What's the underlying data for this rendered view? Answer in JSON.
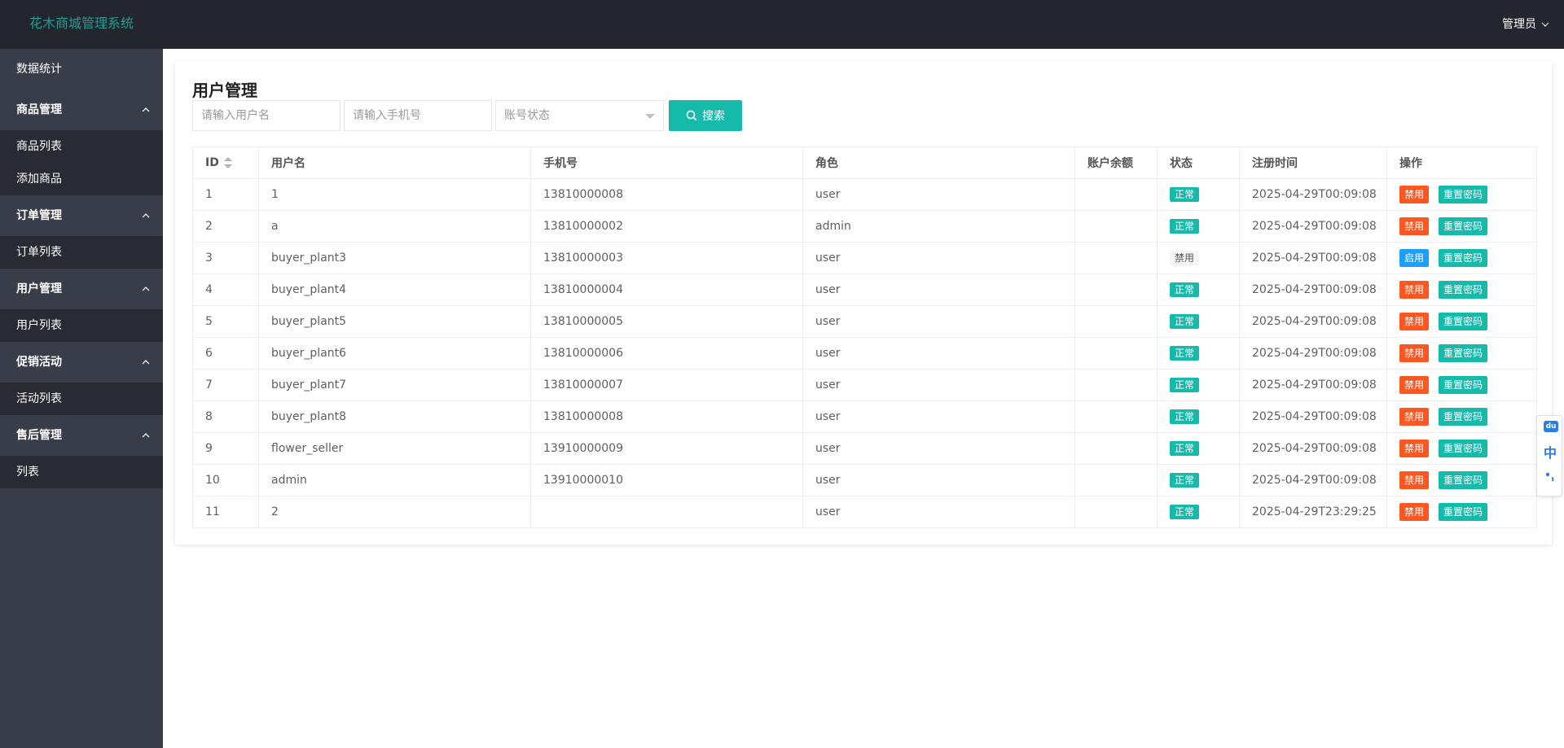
{
  "header": {
    "logo": "花木商城管理系统",
    "user": "管理员"
  },
  "sidebar": {
    "top_item": "数据统计",
    "groups": [
      {
        "title": "商品管理",
        "items": [
          "商品列表",
          "添加商品"
        ]
      },
      {
        "title": "订单管理",
        "items": [
          "订单列表"
        ]
      },
      {
        "title": "用户管理",
        "items": [
          "用户列表"
        ]
      },
      {
        "title": "促销活动",
        "items": [
          "活动列表"
        ]
      },
      {
        "title": "售后管理",
        "items": [
          "列表"
        ]
      }
    ]
  },
  "main": {
    "title": "用户管理",
    "search": {
      "username_placeholder": "请输入用户名",
      "phone_placeholder": "请输入手机号",
      "status_placeholder": "账号状态",
      "search_label": "搜索"
    },
    "table": {
      "headers": [
        "ID",
        "用户名",
        "手机号",
        "角色",
        "账户余额",
        "状态",
        "注册时间",
        "操作"
      ],
      "reset_label": "重置密码",
      "rows": [
        {
          "id": "1",
          "username": "1",
          "phone": "13810000008",
          "role": "user",
          "balance": "",
          "status": "正常",
          "status_type": "ok",
          "time": "2025-04-29T00:09:08",
          "action": "禁用",
          "action_type": "danger"
        },
        {
          "id": "2",
          "username": "a",
          "phone": "13810000002",
          "role": "admin",
          "balance": "",
          "status": "正常",
          "status_type": "ok",
          "time": "2025-04-29T00:09:08",
          "action": "禁用",
          "action_type": "danger"
        },
        {
          "id": "3",
          "username": "buyer_plant3",
          "phone": "13810000003",
          "role": "user",
          "balance": "",
          "status": "禁用",
          "status_type": "off",
          "time": "2025-04-29T00:09:08",
          "action": "启用",
          "action_type": "normal"
        },
        {
          "id": "4",
          "username": "buyer_plant4",
          "phone": "13810000004",
          "role": "user",
          "balance": "",
          "status": "正常",
          "status_type": "ok",
          "time": "2025-04-29T00:09:08",
          "action": "禁用",
          "action_type": "danger"
        },
        {
          "id": "5",
          "username": "buyer_plant5",
          "phone": "13810000005",
          "role": "user",
          "balance": "",
          "status": "正常",
          "status_type": "ok",
          "time": "2025-04-29T00:09:08",
          "action": "禁用",
          "action_type": "danger"
        },
        {
          "id": "6",
          "username": "buyer_plant6",
          "phone": "13810000006",
          "role": "user",
          "balance": "",
          "status": "正常",
          "status_type": "ok",
          "time": "2025-04-29T00:09:08",
          "action": "禁用",
          "action_type": "danger"
        },
        {
          "id": "7",
          "username": "buyer_plant7",
          "phone": "13810000007",
          "role": "user",
          "balance": "",
          "status": "正常",
          "status_type": "ok",
          "time": "2025-04-29T00:09:08",
          "action": "禁用",
          "action_type": "danger"
        },
        {
          "id": "8",
          "username": "buyer_plant8",
          "phone": "13810000008",
          "role": "user",
          "balance": "",
          "status": "正常",
          "status_type": "ok",
          "time": "2025-04-29T00:09:08",
          "action": "禁用",
          "action_type": "danger"
        },
        {
          "id": "9",
          "username": "flower_seller",
          "phone": "13910000009",
          "role": "user",
          "balance": "",
          "status": "正常",
          "status_type": "ok",
          "time": "2025-04-29T00:09:08",
          "action": "禁用",
          "action_type": "danger"
        },
        {
          "id": "10",
          "username": "admin",
          "phone": "13910000010",
          "role": "user",
          "balance": "",
          "status": "正常",
          "status_type": "ok",
          "time": "2025-04-29T00:09:08",
          "action": "禁用",
          "action_type": "danger"
        },
        {
          "id": "11",
          "username": "2",
          "phone": "",
          "role": "user",
          "balance": "",
          "status": "正常",
          "status_type": "ok",
          "time": "2025-04-29T23:29:25",
          "action": "禁用",
          "action_type": "danger"
        }
      ]
    }
  },
  "float_widget": {
    "du": "du",
    "zh": "中"
  },
  "colors": {
    "header_bg": "#23262e",
    "sidebar_bg": "#393d49",
    "sidebar_child_bg": "#282b33",
    "accent": "#16baaa",
    "logo": "#1aa094",
    "danger": "#ff5722",
    "normal": "#1e9fff"
  }
}
